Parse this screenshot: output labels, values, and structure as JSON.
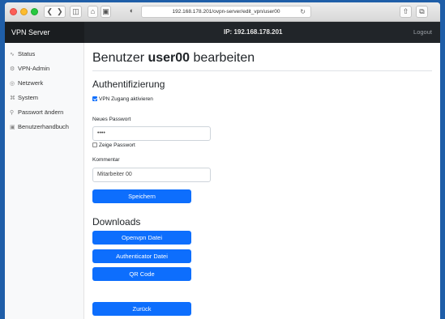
{
  "browser": {
    "url": "192.168.178.201/ovpn-server/edit_vpn/user00"
  },
  "navbar": {
    "brand": "VPN Server",
    "ip": "IP: 192.168.178.201",
    "logout": "Logout"
  },
  "sidebar": {
    "items": [
      {
        "label": "Status",
        "icon": "activity-icon"
      },
      {
        "label": "VPN-Admin",
        "icon": "settings-icon"
      },
      {
        "label": "Netzwerk",
        "icon": "globe-icon"
      },
      {
        "label": "System",
        "icon": "command-icon"
      },
      {
        "label": "Passwort ändern",
        "icon": "key-icon"
      },
      {
        "label": "Benutzerhandbuch",
        "icon": "book-icon"
      }
    ]
  },
  "main": {
    "title_prefix": "Benutzer ",
    "title_user": "user00",
    "title_suffix": " bearbeiten",
    "auth_heading": "Authentifizierung",
    "vpn_checkbox_label": "VPN Zugang aktivieren",
    "password_label": "Neues Passwort",
    "password_value": "••••",
    "show_password_label": "Zeige Passwort",
    "comment_label": "Kommentar",
    "comment_value": "Mitarbeiter 00",
    "save_button": "Speichern",
    "downloads_heading": "Downloads",
    "openvpn_button": "Openvpn Datei",
    "authenticator_button": "Authenticator Datei",
    "qr_button": "QR Code",
    "back_button": "Zurück"
  },
  "colors": {
    "primary": "#0d6efd",
    "navbar": "#212529",
    "desktop": "#1f5ea8"
  }
}
